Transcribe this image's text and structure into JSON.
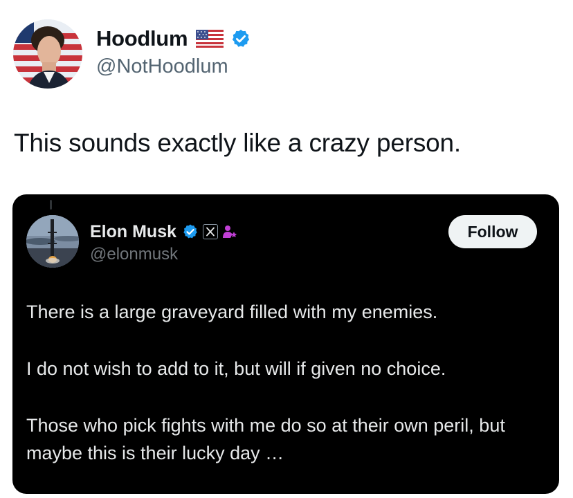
{
  "outer_tweet": {
    "author_name": "Hoodlum",
    "author_handle": "@NotHoodlum",
    "flag_icon": "us-flag-icon",
    "verified_icon": "verified-badge-icon",
    "verified_color": "#1d9bf0",
    "text": "This sounds exactly like a crazy person."
  },
  "quoted_tweet": {
    "author_name": "Elon Musk",
    "author_handle": "@elonmusk",
    "badges": [
      "verified-badge-icon",
      "x-logo-icon",
      "person-star-icon"
    ],
    "badge_colors": {
      "verified": "#1d9bf0",
      "person": "#c13fd6"
    },
    "follow_label": "Follow",
    "paragraphs": [
      "There is a large graveyard filled with my enemies.",
      "I do not wish to add to it, but will if given no choice.",
      "Those who pick fights with me do so at their own peril, but maybe this is their lucky day …"
    ]
  }
}
